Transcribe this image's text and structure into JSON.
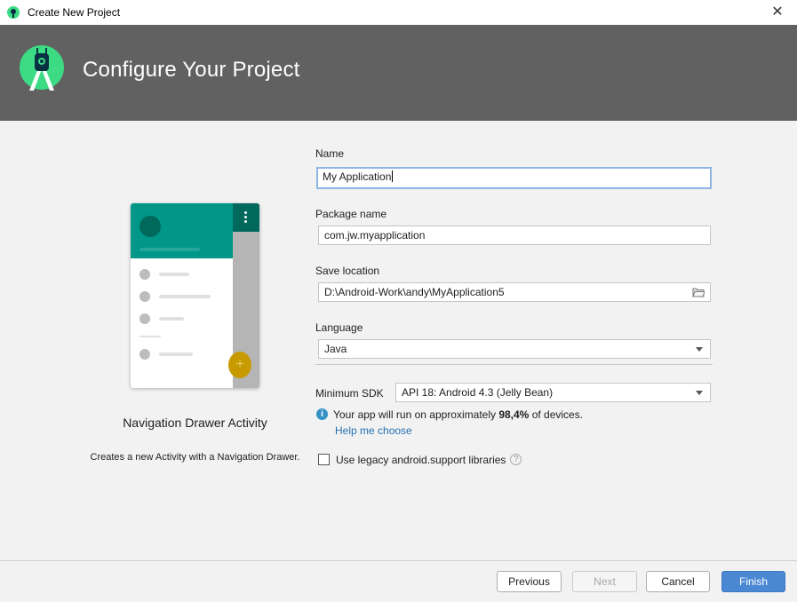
{
  "window": {
    "title": "Create New Project"
  },
  "banner": {
    "title": "Configure Your Project"
  },
  "template": {
    "name": "Navigation Drawer Activity",
    "description": "Creates a new Activity with a Navigation Drawer."
  },
  "form": {
    "name": {
      "label": "Name",
      "value": "My Application"
    },
    "package": {
      "label": "Package name",
      "value": "com.jw.myapplication"
    },
    "save_location": {
      "label": "Save location",
      "value": "D:\\Android-Work\\andy\\MyApplication5"
    },
    "language": {
      "label": "Language",
      "value": "Java"
    },
    "min_sdk": {
      "label": "Minimum SDK",
      "value": "API 18: Android 4.3 (Jelly Bean)"
    },
    "info": {
      "prefix": "Your app will run on approximately ",
      "percent": "98,4%",
      "suffix": " of devices."
    },
    "help_link": "Help me choose",
    "legacy_checkbox": {
      "label": "Use legacy android.support libraries",
      "checked": false
    }
  },
  "buttons": {
    "previous": "Previous",
    "next": "Next",
    "cancel": "Cancel",
    "finish": "Finish"
  },
  "colors": {
    "banner_bg": "#616161",
    "accent_green": "#3ddc84",
    "drawer_teal": "#009688",
    "primary_button": "#4a88d3",
    "link": "#2470b3"
  }
}
